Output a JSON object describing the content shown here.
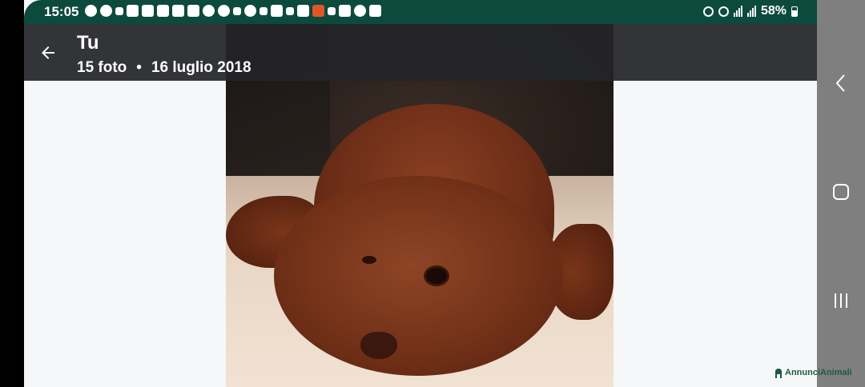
{
  "status_bar": {
    "time": "15:05",
    "battery": "58%",
    "background_color": "#0d4a3e"
  },
  "app_bar": {
    "title": "Tu",
    "photo_count": "15 foto",
    "separator": "•",
    "date": "16 luglio 2018"
  },
  "photo": {
    "subject": "brown curly poodle lying on a blanket"
  },
  "nav_bar": {
    "buttons": [
      "back-nav-icon",
      "home-nav-icon",
      "recents-nav-icon"
    ]
  },
  "watermark": {
    "text": "AnnunciAnimali"
  }
}
